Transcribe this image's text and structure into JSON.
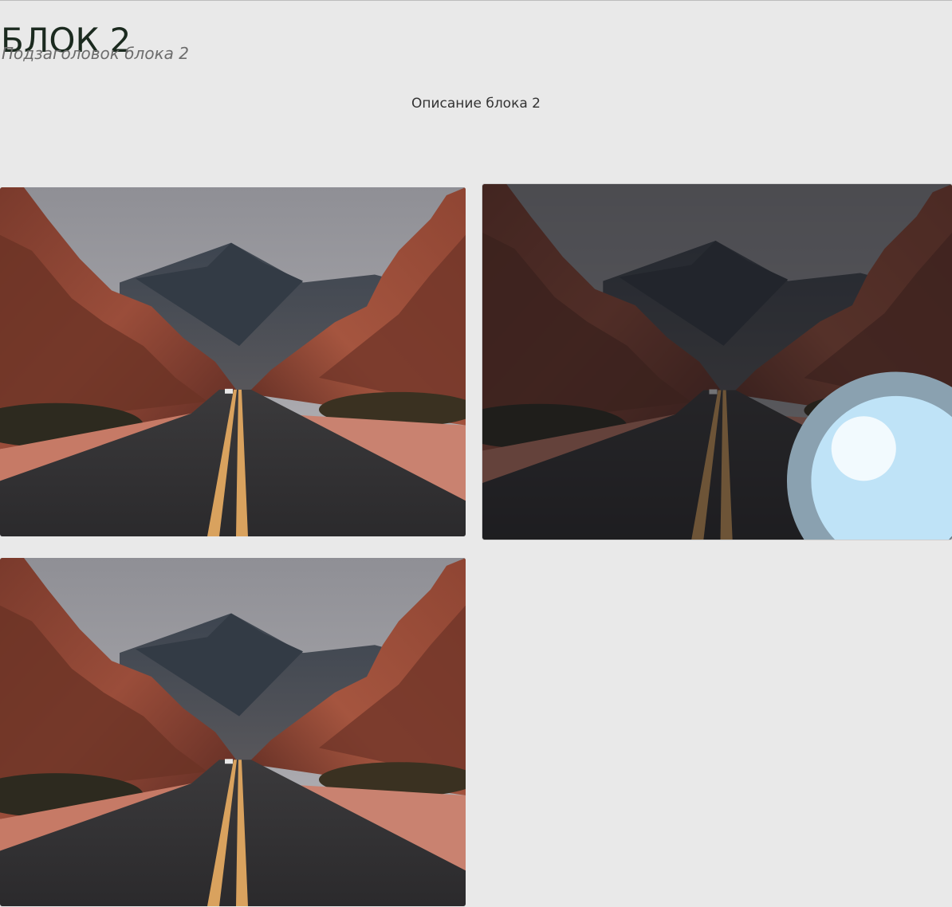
{
  "block": {
    "title": "БЛОК 2",
    "subtitle": "Подзаголовок блока 2",
    "description": "Описание блока 2"
  },
  "gallery": {
    "images": [
      {
        "name": "road-canyon-photo-1",
        "state": "normal"
      },
      {
        "name": "road-canyon-photo-2",
        "state": "hover",
        "hover_icon": "magnifier-icon"
      },
      {
        "name": "road-canyon-photo-3",
        "state": "normal"
      }
    ]
  },
  "colors": {
    "background": "#e9e9e9",
    "title": "#1b2a1f",
    "subtitle": "#6c6c6c",
    "description": "#333333"
  }
}
